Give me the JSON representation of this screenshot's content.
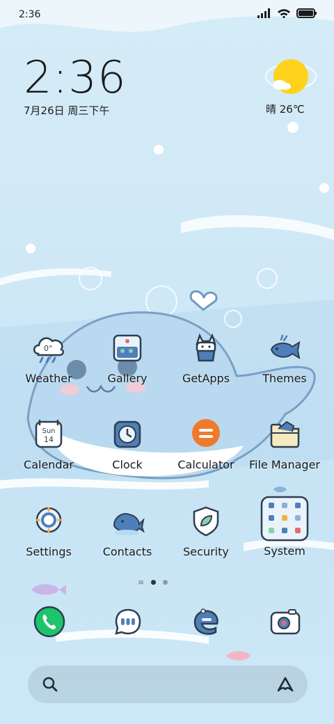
{
  "status_bar": {
    "time": "2:36"
  },
  "clock_widget": {
    "time": "2:36",
    "date": "7月26日 周三下午"
  },
  "weather_widget": {
    "condition": "晴",
    "temperature": "26℃",
    "text": "晴 26℃"
  },
  "apps": [
    {
      "label": "Weather",
      "icon": "weather-cloud-icon"
    },
    {
      "label": "Gallery",
      "icon": "gallery-icon"
    },
    {
      "label": "GetApps",
      "icon": "getapps-icon"
    },
    {
      "label": "Themes",
      "icon": "themes-icon"
    },
    {
      "label": "Calendar",
      "icon": "calendar-icon",
      "day": "Sun",
      "date": "14"
    },
    {
      "label": "Clock",
      "icon": "clock-icon"
    },
    {
      "label": "Calculator",
      "icon": "calculator-icon"
    },
    {
      "label": "File Manager",
      "icon": "file-manager-icon"
    },
    {
      "label": "Settings",
      "icon": "settings-icon"
    },
    {
      "label": "Contacts",
      "icon": "contacts-icon"
    },
    {
      "label": "Security",
      "icon": "security-icon"
    },
    {
      "label": "System",
      "icon": "system-folder-icon"
    }
  ],
  "weather_icon_temp": "0°",
  "dock": [
    {
      "name": "phone",
      "icon": "phone-icon"
    },
    {
      "name": "messages",
      "icon": "messages-icon"
    },
    {
      "name": "browser",
      "icon": "browser-icon"
    },
    {
      "name": "camera",
      "icon": "camera-icon"
    }
  ],
  "page_indicator": {
    "pages": 2,
    "current": 1
  },
  "colors": {
    "accent_blue": "#4f7fb8",
    "phone_green": "#1ec46b",
    "calculator_orange": "#f07a2b",
    "sun_yellow": "#ffd21e"
  }
}
